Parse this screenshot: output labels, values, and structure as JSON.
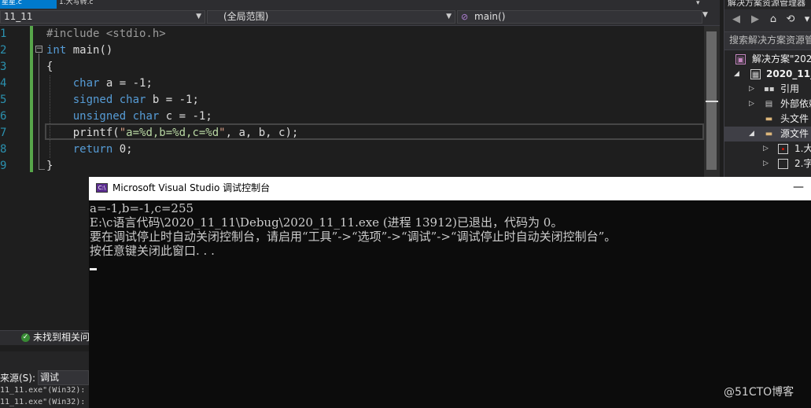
{
  "tabs": {
    "active": "星星.c",
    "second": "1.大写转.c",
    "overflow": "▾"
  },
  "navbar": {
    "project": "11_11",
    "scope": "(全局范围)",
    "function": "main()"
  },
  "editor": {
    "line_numbers": [
      "1",
      "2",
      "3",
      "4",
      "5",
      "6",
      "7",
      "8",
      "9"
    ]
  },
  "statusbar": {
    "zoom": "",
    "message": "未找到相关问题"
  },
  "output": {
    "source_label": "来源(S):",
    "source_value": "调试",
    "lines": [
      "11_11.exe\"(Win32):",
      "11_11.exe\"(Win32):"
    ]
  },
  "solution_explorer": {
    "title": "解决方案资源管理器",
    "search_placeholder": "搜索解决方案资源管理器",
    "items": [
      {
        "label": "解决方案\"2020"
      },
      {
        "label": "2020_11_11"
      },
      {
        "label": "引用"
      },
      {
        "label": "外部依赖项"
      },
      {
        "label": "头文件"
      },
      {
        "label": "源文件"
      },
      {
        "label": "1.大"
      },
      {
        "label": "2.字"
      }
    ]
  },
  "console": {
    "title": "Microsoft Visual Studio 调试控制台",
    "icon_text": "C:\\",
    "lines": [
      "a=-1,b=-1,c=255",
      "E:\\c语言代码\\2020_11_11\\Debug\\2020_11_11.exe (进程 13912)已退出，代码为 0。",
      "要在调试停止时自动关闭控制台，请启用“工具”->“选项”->“调试”->“调试停止时自动关闭控制台”。",
      "按任意键关闭此窗口. . ."
    ]
  },
  "watermark": "@51CTO博客",
  "colors": {
    "keyword": "#569cd6",
    "string": "#d69d85",
    "line_number": "#2b91af",
    "accent": "#007acc",
    "console_bg": "#0c0c0c"
  }
}
